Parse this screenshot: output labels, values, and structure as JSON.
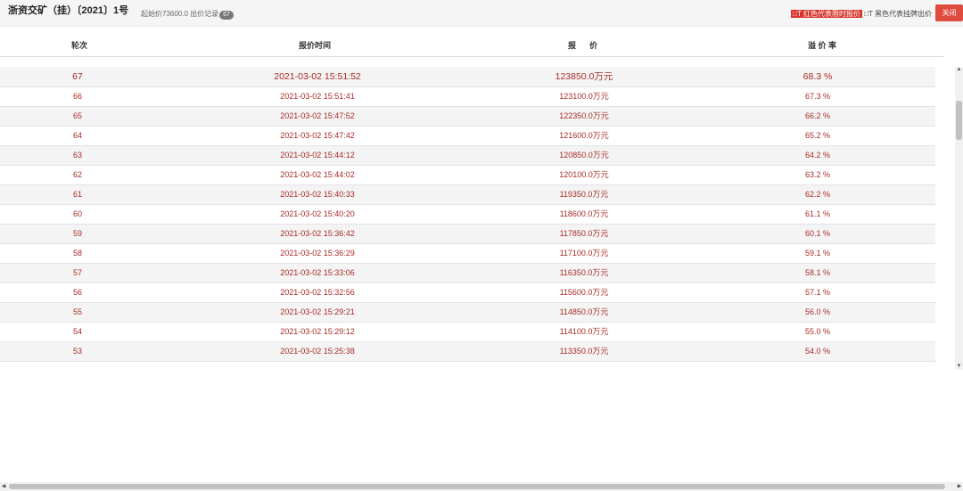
{
  "header": {
    "title": "浙资交矿（挂）〔2021〕1号",
    "start_price_label": "起始价73600.0 出价记录",
    "record_count": "67",
    "legend_red": "□T 红色代表限时报价",
    "legend_black": "□T 黑色代表挂牌出价",
    "close_label": "关闭"
  },
  "table": {
    "columns": [
      "轮次",
      "报价时间",
      "报      价",
      "溢 价 率"
    ],
    "rows": [
      {
        "round": "67",
        "time": "2021-03-02 15:51:52",
        "price": "123850.0万元",
        "rate": "68.3 %"
      },
      {
        "round": "66",
        "time": "2021-03-02 15:51:41",
        "price": "123100.0万元",
        "rate": "67.3 %"
      },
      {
        "round": "65",
        "time": "2021-03-02 15:47:52",
        "price": "122350.0万元",
        "rate": "66.2 %"
      },
      {
        "round": "64",
        "time": "2021-03-02 15:47:42",
        "price": "121600.0万元",
        "rate": "65.2 %"
      },
      {
        "round": "63",
        "time": "2021-03-02 15:44:12",
        "price": "120850.0万元",
        "rate": "64.2 %"
      },
      {
        "round": "62",
        "time": "2021-03-02 15:44:02",
        "price": "120100.0万元",
        "rate": "63.2 %"
      },
      {
        "round": "61",
        "time": "2021-03-02 15:40:33",
        "price": "119350.0万元",
        "rate": "62.2 %"
      },
      {
        "round": "60",
        "time": "2021-03-02 15:40:20",
        "price": "118600.0万元",
        "rate": "61.1 %"
      },
      {
        "round": "59",
        "time": "2021-03-02 15:36:42",
        "price": "117850.0万元",
        "rate": "60.1 %"
      },
      {
        "round": "58",
        "time": "2021-03-02 15:36:29",
        "price": "117100.0万元",
        "rate": "59.1 %"
      },
      {
        "round": "57",
        "time": "2021-03-02 15:33:06",
        "price": "116350.0万元",
        "rate": "58.1 %"
      },
      {
        "round": "56",
        "time": "2021-03-02 15:32:56",
        "price": "115600.0万元",
        "rate": "57.1 %"
      },
      {
        "round": "55",
        "time": "2021-03-02 15:29:21",
        "price": "114850.0万元",
        "rate": "56.0 %"
      },
      {
        "round": "54",
        "time": "2021-03-02 15:29:12",
        "price": "114100.0万元",
        "rate": "55.0 %"
      },
      {
        "round": "53",
        "time": "2021-03-02 15:25:38",
        "price": "113350.0万元",
        "rate": "54.0 %"
      }
    ]
  },
  "colors": {
    "row_text": "#a72b26",
    "close_button": "#e04b3f",
    "legend_red_bg": "#d9352c"
  },
  "icons": {
    "scroll_up": "scroll-up-arrow-icon",
    "scroll_down": "scroll-down-arrow-icon",
    "scroll_left": "scroll-left-arrow-icon",
    "scroll_right": "scroll-right-arrow-icon"
  }
}
